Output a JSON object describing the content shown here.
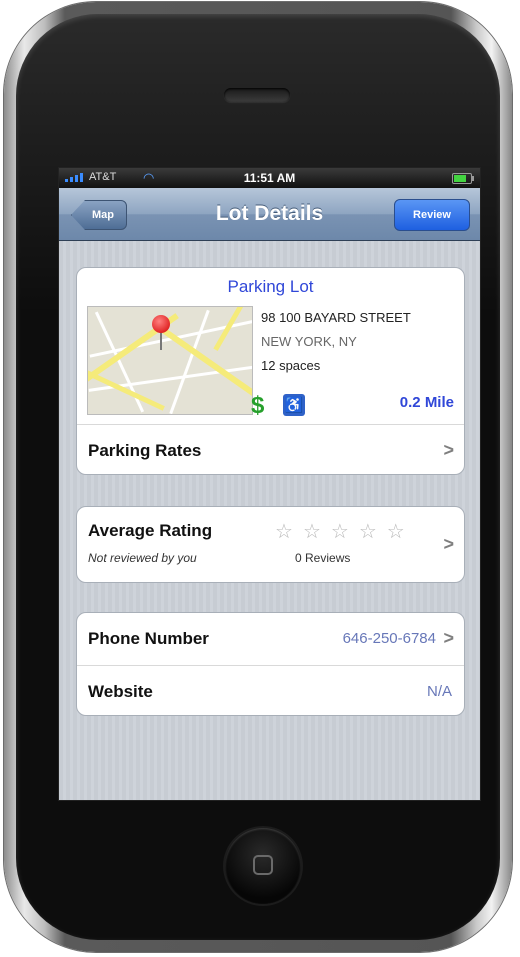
{
  "status_bar": {
    "carrier": "AT&T",
    "time": "11:51 AM"
  },
  "nav": {
    "back_label": "Map",
    "title": "Lot Details",
    "review_label": "Review"
  },
  "lot": {
    "name": "Parking Lot",
    "address_line1": "98 100 BAYARD STREET",
    "address_line2": "NEW YORK, NY",
    "spaces": "12 spaces",
    "price_symbol": "$",
    "accessibility_symbol": "♿",
    "distance": "0.2 Mile"
  },
  "rates": {
    "label": "Parking Rates"
  },
  "rating": {
    "label": "Average Rating",
    "stars_filled": 0,
    "stars_total": 5,
    "subtitle": "Not reviewed by you",
    "reviews": "0 Reviews"
  },
  "contact": {
    "phone_label": "Phone Number",
    "phone_value": "646-250-6784",
    "website_label": "Website",
    "website_value": "N/A"
  },
  "colors": {
    "link_blue": "#3047d8",
    "nav_blue": "#6d88aa",
    "review_button": "#1e5fe0",
    "dollar_green": "#27a02c"
  },
  "icons": {
    "chevron": ">",
    "star": "☆"
  }
}
